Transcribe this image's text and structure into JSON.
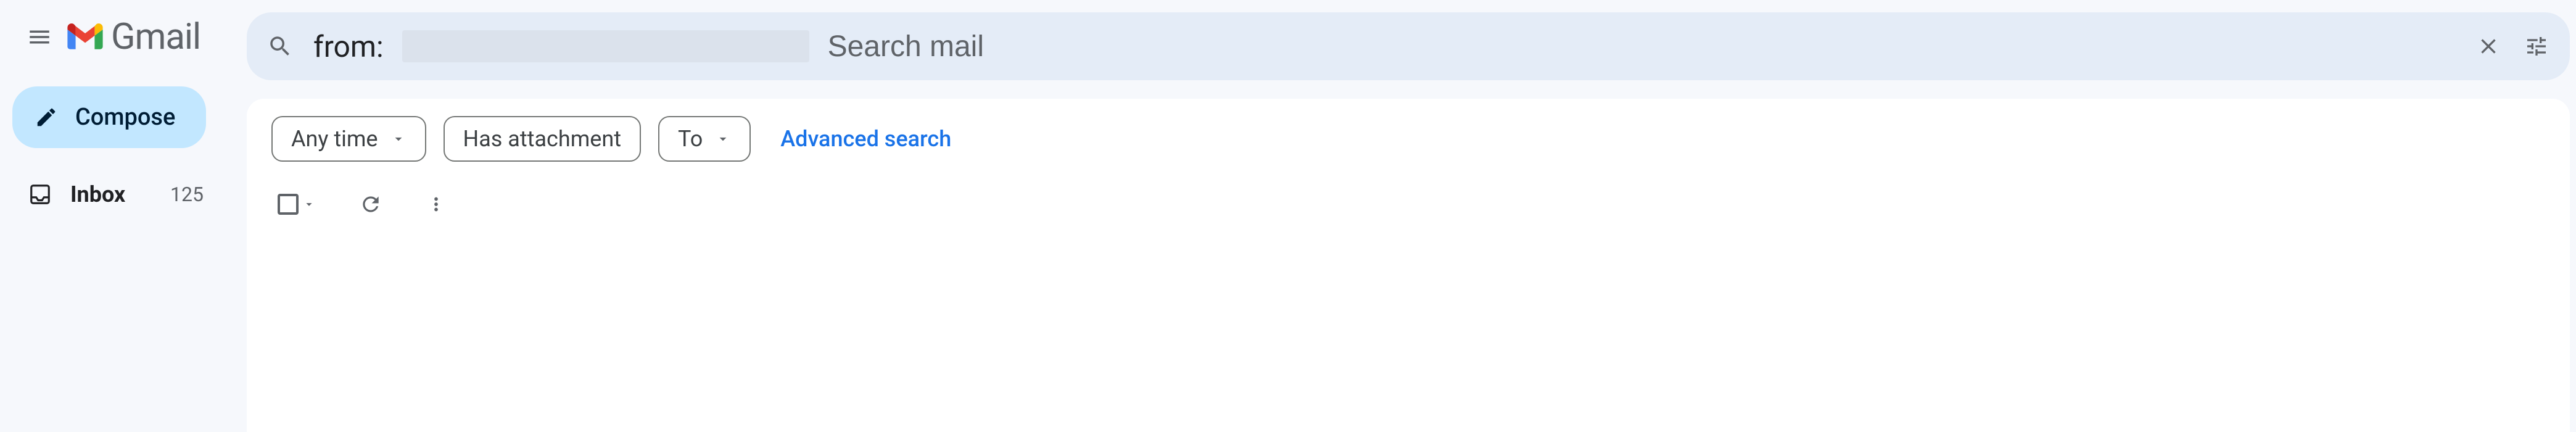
{
  "header": {
    "product_name": "Gmail"
  },
  "sidebar": {
    "compose_label": "Compose",
    "items": [
      {
        "label": "Inbox",
        "count": "125"
      }
    ]
  },
  "search": {
    "value_prefix": "from:",
    "value_redacted": true,
    "placeholder": "Search mail"
  },
  "filters": {
    "any_time": "Any time",
    "has_attachment": "Has attachment",
    "to": "To",
    "advanced": "Advanced search"
  }
}
